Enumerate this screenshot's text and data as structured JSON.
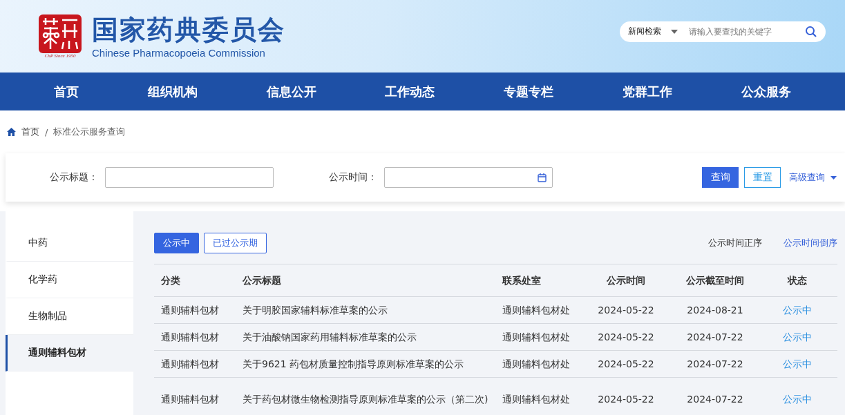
{
  "header": {
    "logo_caption": "ChP Since 1950",
    "title": "国家药典委员会",
    "subtitle": "Chinese Pharmacopoeia Commission",
    "search": {
      "scope": "新闻检索",
      "placeholder": "请输入要查找的关键字"
    }
  },
  "nav": [
    {
      "label": "首页"
    },
    {
      "label": "组织机构"
    },
    {
      "label": "信息公开"
    },
    {
      "label": "工作动态"
    },
    {
      "label": "专题专栏"
    },
    {
      "label": "党群工作"
    },
    {
      "label": "公众服务"
    }
  ],
  "breadcrumb": [
    "首页",
    "/",
    "标准公示服务查询"
  ],
  "filter": {
    "title_label": "公示标题：",
    "time_label": "公示时间：",
    "buttons": [
      {
        "label": "查询",
        "kind": "primary"
      },
      {
        "label": "重置",
        "kind": "outline"
      }
    ],
    "advanced": "高级查询"
  },
  "sidebar": {
    "items": [
      {
        "label": "中药",
        "selected": false
      },
      {
        "label": "化学药",
        "selected": false
      },
      {
        "label": "生物制品",
        "selected": false
      },
      {
        "label": "通则辅料包材",
        "selected": true
      }
    ]
  },
  "tabs": [
    {
      "label": "公示中",
      "selected": true
    },
    {
      "label": "已过公示期",
      "selected": false
    }
  ],
  "sort": [
    {
      "label": "公示时间正序",
      "selected": false
    },
    {
      "label": "公示时间倒序",
      "selected": true
    }
  ],
  "table": {
    "columns": [
      "分类",
      "公示标题",
      "联系处室",
      "公示时间",
      "公示截至时间",
      "状态"
    ],
    "rows": [
      [
        "通则辅料包材",
        "关于明胶国家辅料标准草案的公示",
        "通则辅料包材处",
        "2024-05-22",
        "2024-08-21",
        "公示中"
      ],
      [
        "通则辅料包材",
        "关于油酸钠国家药用辅料标准草案的公示",
        "通则辅料包材处",
        "2024-05-22",
        "2024-07-22",
        "公示中"
      ],
      [
        "通则辅料包材",
        "关于9621 药包材质量控制指导原则标准草案的公示",
        "通则辅料包材处",
        "2024-05-22",
        "2024-07-22",
        "公示中"
      ],
      [
        "通则辅料包材",
        "关于药包材微生物检测指导原则标准草案的公示（第二次)",
        "通则辅料包材处",
        "2024-05-22",
        "2024-07-22",
        "公示中"
      ]
    ]
  }
}
